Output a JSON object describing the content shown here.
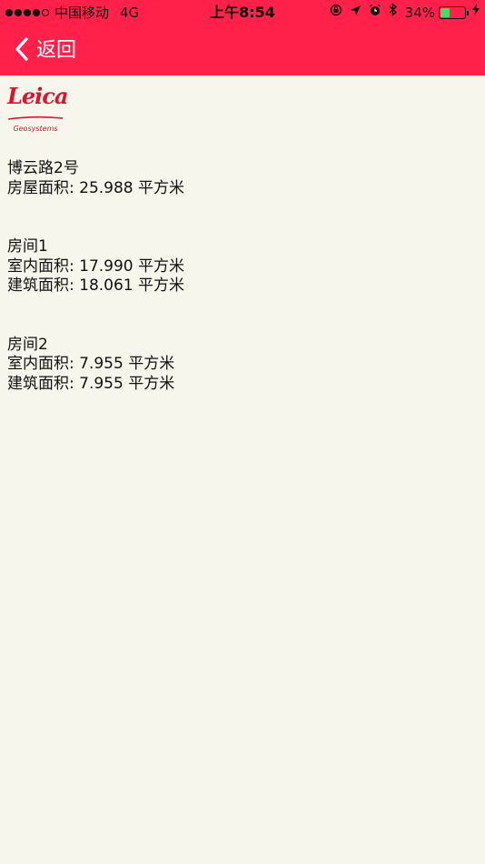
{
  "status_bar": {
    "carrier": "中国移动",
    "network": "4G",
    "time": "上午8:54",
    "battery_percent": "34%",
    "battery_level": 0.34
  },
  "nav": {
    "back_label": "返回"
  },
  "logo": {
    "word": "Leica",
    "sub": "Geosystems"
  },
  "address": {
    "name": "博云路2号",
    "house_area": "房屋面积: 25.988 平方米"
  },
  "rooms": [
    {
      "name": "房间1",
      "indoor_area": "室内面积: 17.990 平方米",
      "building_area": "建筑面积: 18.061 平方米"
    },
    {
      "name": "房间2",
      "indoor_area": "室内面积: 7.955 平方米",
      "building_area": "建筑面积: 7.955 平方米"
    }
  ],
  "colors": {
    "header": "#ff2149",
    "background": "#f7f6ec",
    "logo": "#d7172f"
  },
  "icons": {
    "back": "chevron-left-icon",
    "orientation_lock": "orientation-lock-icon",
    "location": "location-arrow-icon",
    "alarm": "alarm-icon",
    "bluetooth": "bluetooth-icon",
    "battery": "battery-icon",
    "charging": "charging-bolt-icon"
  }
}
